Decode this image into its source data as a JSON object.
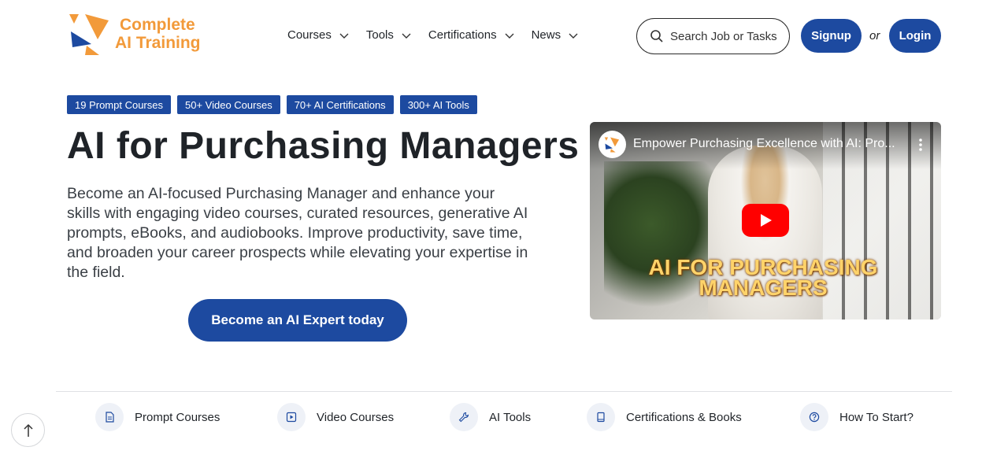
{
  "brand": {
    "line1": "Complete",
    "line2": "AI Training",
    "color": "#f29a3a"
  },
  "nav": [
    {
      "label": "Courses"
    },
    {
      "label": "Tools"
    },
    {
      "label": "Certifications"
    },
    {
      "label": "News"
    }
  ],
  "search": {
    "placeholder": "Search Job or Tasks"
  },
  "auth": {
    "signup": "Signup",
    "or": "or",
    "login": "Login"
  },
  "badges": [
    "19 Prompt Courses",
    "50+ Video Courses",
    "70+ AI Certifications",
    "300+ AI Tools"
  ],
  "hero": {
    "title": "AI for Purchasing Managers",
    "description": "Become an AI-focused Purchasing Manager and enhance your skills with engaging video courses, curated resources, generative AI prompts, eBooks, and audiobooks. Improve productivity, save time, and broaden your career prospects while elevating your expertise in the field.",
    "cta": "Become an AI Expert today"
  },
  "video": {
    "title": "Empower Purchasing Excellence with AI: Pro...",
    "overlay_line1": "AI FOR PURCHASING",
    "overlay_line2": "MANAGERS",
    "channel_logo_text": "Complete AI Training"
  },
  "bottom_nav": [
    {
      "label": "Prompt Courses",
      "icon": "document-icon"
    },
    {
      "label": "Video Courses",
      "icon": "play-square-icon"
    },
    {
      "label": "AI Tools",
      "icon": "wrench-icon"
    },
    {
      "label": "Certifications & Books",
      "icon": "book-icon"
    },
    {
      "label": "How To Start?",
      "icon": "question-icon"
    }
  ],
  "colors": {
    "primary": "#1d4aa0",
    "accent": "#f29a3a",
    "youtube_red": "#ff0000"
  }
}
